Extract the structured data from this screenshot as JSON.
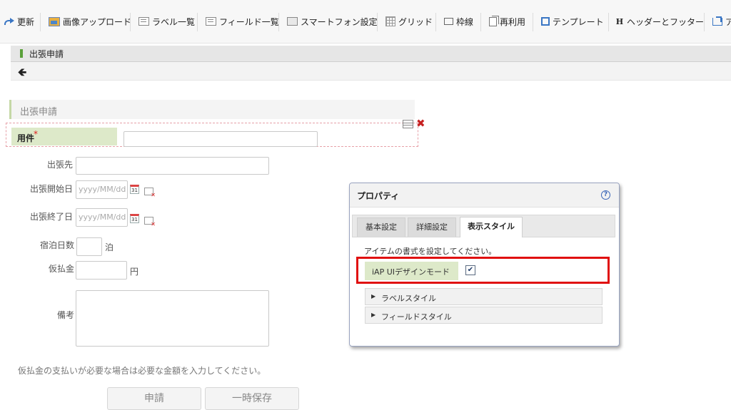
{
  "toolbar": {
    "refresh": "更新",
    "image_upload": "画像アップロード",
    "label_list": "ラベル一覧",
    "field_list": "フィールド一覧",
    "smartphone_settings": "スマートフォン設定",
    "grid": "グリッド",
    "frame": "枠線",
    "reuse": "再利用",
    "template": "テンプレート",
    "header_footer": "ヘッダーとフッター",
    "cut_off": "ア"
  },
  "page": {
    "title": "出張申請"
  },
  "form": {
    "section_title": "出張申請",
    "required_label": "用件",
    "required_mark": "*",
    "destination_label": "出張先",
    "start_date_label": "出張開始日",
    "end_date_label": "出張終了日",
    "date_placeholder": "yyyy/MM/dd",
    "calendar_day": "31",
    "nights_label": "宿泊日数",
    "nights_unit": "泊",
    "advance_label": "仮払金",
    "advance_unit": "円",
    "remarks_label": "備考",
    "note": "仮払金の支払いが必要な場合は必要な金額を入力してください。",
    "submit_button": "申請",
    "draft_button": "一時保存"
  },
  "dialog": {
    "title": "プロパティ",
    "help": "?",
    "tabs": [
      "基本設定",
      "詳細設定",
      "表示スタイル"
    ],
    "active_tab": 2,
    "description": "アイテムの書式を設定してください。",
    "iap_mode_label": "iAP UIデザインモード",
    "iap_mode_checked": true,
    "check_mark": "✔",
    "label_style": "ラベルスタイル",
    "field_style": "フィールドスタイル"
  },
  "colors": {
    "accent_green": "#dde9c9",
    "highlight_red": "#e01010",
    "link_blue": "#3a66b8"
  }
}
